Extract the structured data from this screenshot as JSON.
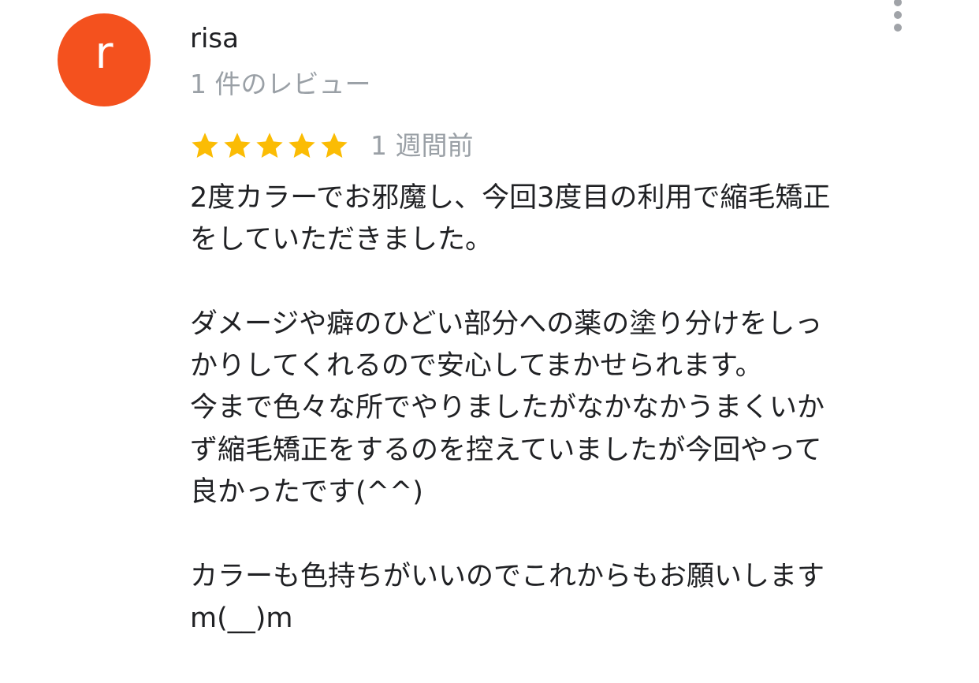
{
  "review": {
    "avatar_letter": "r",
    "avatar_color": "#f4511e",
    "author_name": "risa",
    "review_count": "1 件のレビュー",
    "rating": 5,
    "rating_max": 5,
    "star_color": "#fbbc04",
    "date": "1 週間前",
    "more_icon": "more-vert-icon",
    "text": "2度カラーでお邪魔し、今回3度目の利用で縮毛矯正\nをしていただきました。\n\nダメージや癖のひどい部分への薬の塗り分けをしっ\nかりしてくれるので安心してまかせられます。\n今まで色々な所でやりましたがなかなかうまくいか\nず縮毛矯正をするのを控えていましたが今回やって\n良かったです(^^)\n\nカラーも色持ちがいいのでこれからもお願いします\nm(__)m"
  }
}
